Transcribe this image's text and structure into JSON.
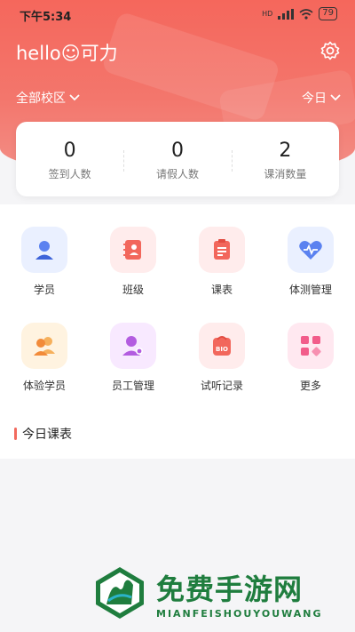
{
  "status_bar": {
    "time": "下午5:34",
    "network": "HD",
    "battery": "79"
  },
  "header": {
    "greeting": "hello☺可力",
    "campus": "全部校区",
    "date_filter": "今日"
  },
  "stats": [
    {
      "value": "0",
      "label": "签到人数"
    },
    {
      "value": "0",
      "label": "请假人数"
    },
    {
      "value": "2",
      "label": "课消数量"
    }
  ],
  "grid": [
    {
      "label": "学员",
      "icon": "student-icon"
    },
    {
      "label": "班级",
      "icon": "class-icon"
    },
    {
      "label": "课表",
      "icon": "schedule-icon"
    },
    {
      "label": "体测管理",
      "icon": "fitness-test-icon"
    },
    {
      "label": "体验学员",
      "icon": "trial-student-icon"
    },
    {
      "label": "员工管理",
      "icon": "staff-icon"
    },
    {
      "label": "试听记录",
      "icon": "audition-record-icon"
    },
    {
      "label": "更多",
      "icon": "more-icon"
    }
  ],
  "section_title": "今日课表",
  "watermark": {
    "cn": "免费手游网",
    "en": "MIANFEISHOUYOUWANG"
  },
  "colors": {
    "accent": "#f26a5e",
    "brand_green": "#1f7d3e"
  }
}
